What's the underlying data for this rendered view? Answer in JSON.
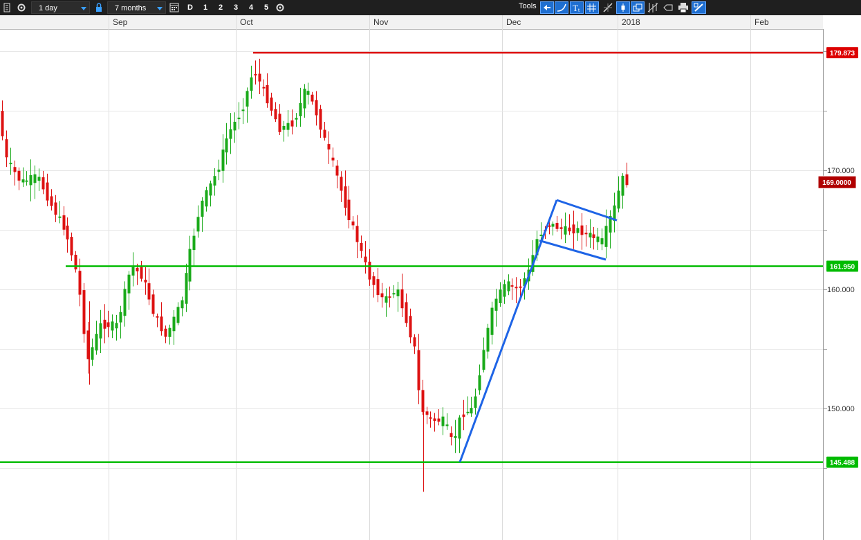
{
  "toolbar": {
    "interval": "1 day",
    "range": "7 months",
    "period_buttons": [
      "D",
      "1",
      "2",
      "3",
      "4",
      "5"
    ],
    "tools_label": "Tools",
    "colors": {
      "background": "#1f1f1f",
      "accent": "#1f6fd1"
    },
    "icons": [
      "menu-icon",
      "gear-icon",
      "lock-icon",
      "calendar-icon",
      "settings-icon",
      "back-arrow-icon",
      "curve-icon",
      "text-icon",
      "grid-icon",
      "draw-icon",
      "candle-icon",
      "windows-icon",
      "fib-icon",
      "label-icon",
      "print-icon",
      "draw-tools-icon"
    ]
  },
  "chart_data": {
    "type": "candlestick",
    "x_labels": [
      "Sep",
      "Oct",
      "Nov",
      "Dec",
      "2018",
      "Feb"
    ],
    "y_labels": [
      "170.000",
      "160.000",
      "150.000"
    ],
    "y_range": [
      141.5,
      182.5
    ],
    "grid": true,
    "last_price": "169.0000",
    "last_price_value": 169.0,
    "horizontal_lines": [
      {
        "label": "179.873",
        "value": 179.873,
        "color": "#dd0000"
      },
      {
        "label": "161.950",
        "value": 161.95,
        "color": "#00bb00"
      },
      {
        "label": "145.488",
        "value": 145.488,
        "color": "#00bb00"
      }
    ],
    "trendlines_color": "#1e64e6",
    "colors": {
      "up": "#1aaa1a",
      "down": "#dd1111"
    }
  }
}
